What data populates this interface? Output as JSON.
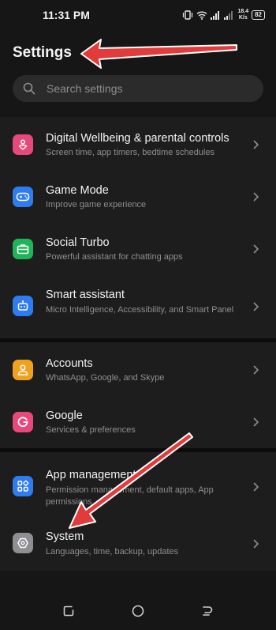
{
  "status_bar": {
    "time": "11:31 PM",
    "net_speed_value": "18.4",
    "net_speed_unit": "K/s",
    "battery": "82"
  },
  "header": {
    "title": "Settings"
  },
  "search": {
    "placeholder": "Search settings"
  },
  "items": [
    {
      "label": "Digital Wellbeing & parental controls",
      "subtitle": "Screen time, app timers, bedtime schedules",
      "icon": "heart-person-icon",
      "color": "#e8497a"
    },
    {
      "label": "Game Mode",
      "subtitle": "Improve game experience",
      "icon": "gamepad-icon",
      "color": "#2f7cf0"
    },
    {
      "label": "Social Turbo",
      "subtitle": "Powerful assistant for chatting apps",
      "icon": "briefcase-icon",
      "color": "#1fb35a"
    },
    {
      "label": "Smart assistant",
      "subtitle": "Micro Intelligence, Accessibility, and Smart Panel",
      "icon": "robot-icon",
      "color": "#2f7cf0"
    },
    {
      "label": "Accounts",
      "subtitle": "WhatsApp, Google, and Skype",
      "icon": "person-icon",
      "color": "#f0a21e"
    },
    {
      "label": "Google",
      "subtitle": "Services & preferences",
      "icon": "google-g-icon",
      "color": "#e8497a"
    },
    {
      "label": "App management",
      "subtitle": "Permission management, default apps, App permissions",
      "icon": "apps-grid-icon",
      "color": "#2f7cf0"
    },
    {
      "label": "System",
      "subtitle": "Languages, time, backup, updates",
      "icon": "hexagon-icon",
      "color": "#8e8e93"
    }
  ],
  "colors": {
    "background": "#161616",
    "group": "#1d1d1d",
    "annotation_arrow": "#e23b3b"
  }
}
